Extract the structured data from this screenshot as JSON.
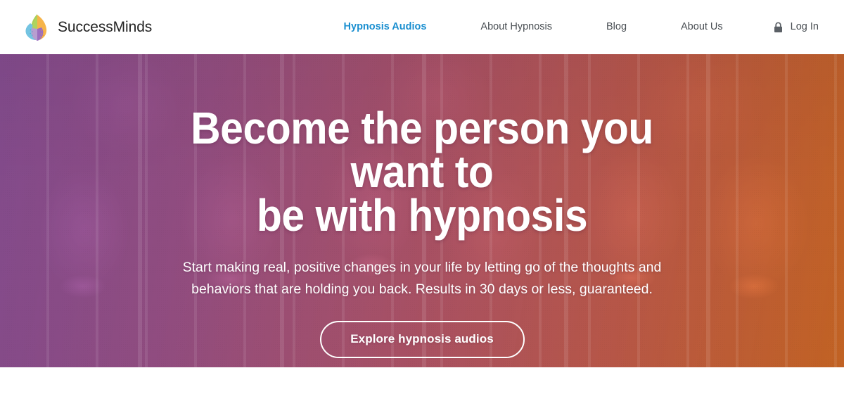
{
  "header": {
    "brand": {
      "name": "SuccessMinds",
      "logo_icon": "colored-petals-leaf-logo-icon"
    },
    "nav": [
      {
        "label": "Hypnosis Audios",
        "active": true
      },
      {
        "label": "About Hypnosis",
        "active": false
      },
      {
        "label": "Blog",
        "active": false
      },
      {
        "label": "About Us",
        "active": false
      }
    ],
    "login": {
      "label": "Log In",
      "icon": "lock-icon"
    },
    "active_link_color": "#1b8fd0",
    "link_color": "#4a4f54",
    "background": "#ffffff"
  },
  "hero": {
    "title": "Become the person you want to be with hypnosis",
    "title_line_1": "Become the person you want to",
    "title_line_2": "be with hypnosis",
    "subtitle": "Start making real, positive changes in your life by letting go of the thoughts and behaviors that are holding you back. Results in 30 days or less, guaranteed.",
    "cta_label": "Explore hypnosis audios",
    "text_color": "#ffffff",
    "gradient_start": "#964eaa",
    "gradient_end": "#f37824",
    "background_description": "tiled photo collage of smiling faces under a purple-to-orange duotone gradient with vertical panel dividers"
  },
  "colors": {
    "accent_blue": "#1b8fd0",
    "page_background": "#ffffff",
    "hero_purple": "#964eaa",
    "hero_orange": "#f37824"
  }
}
